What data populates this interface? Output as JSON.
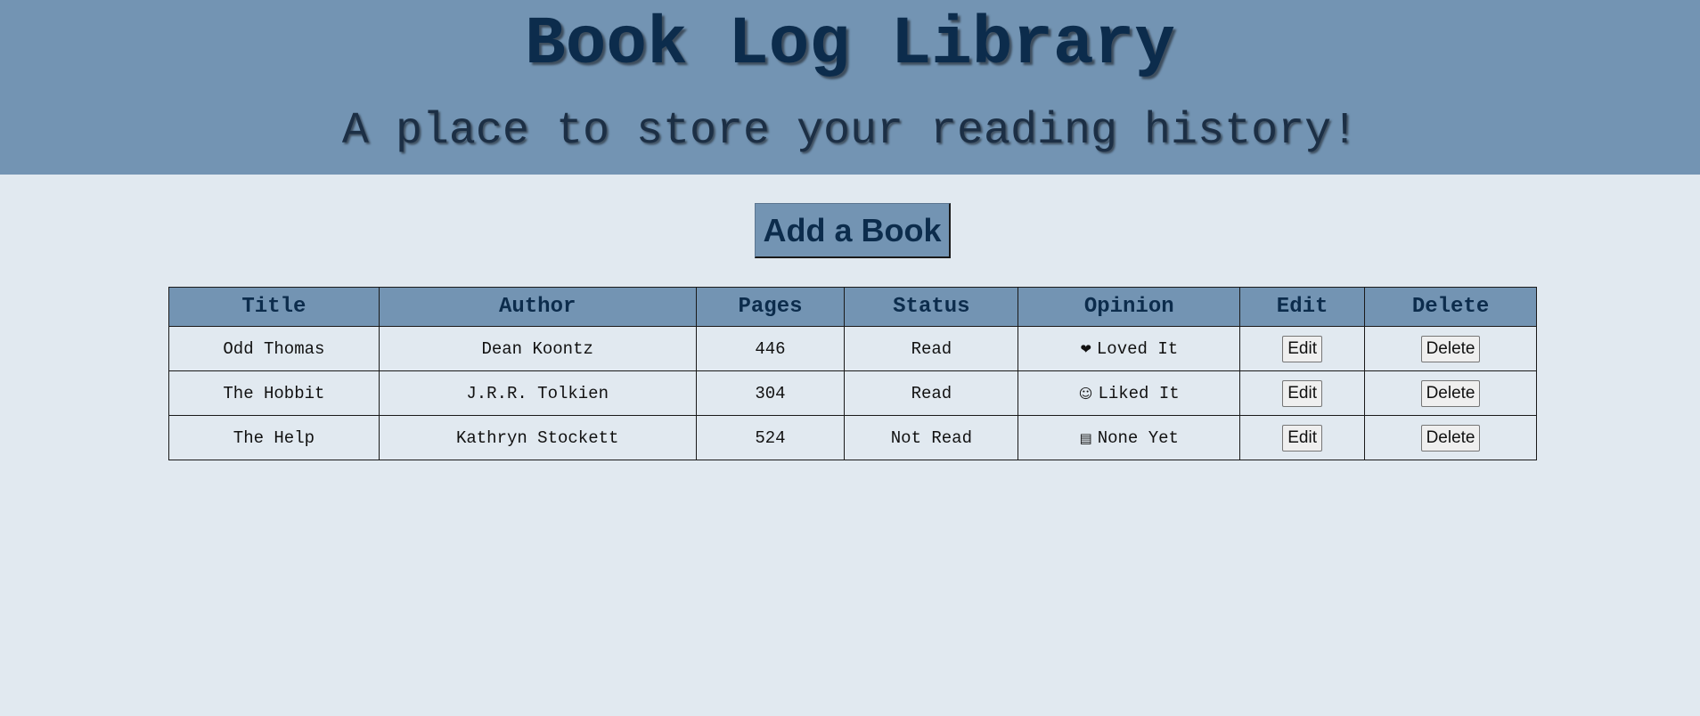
{
  "header": {
    "title": "Book Log Library",
    "subtitle": "A place to store your reading history!"
  },
  "actions": {
    "add_book_label": "Add a Book"
  },
  "table": {
    "columns": [
      "Title",
      "Author",
      "Pages",
      "Status",
      "Opinion",
      "Edit",
      "Delete"
    ],
    "rows": [
      {
        "title": "Odd Thomas",
        "author": "Dean Koontz",
        "pages": "446",
        "status": "Read",
        "opinion_icon": "❤",
        "opinion_icon_name": "heart-icon",
        "opinion": "Loved It",
        "edit_label": "Edit",
        "delete_label": "Delete"
      },
      {
        "title": "The Hobbit",
        "author": "J.R.R. Tolkien",
        "pages": "304",
        "status": "Read",
        "opinion_icon": "☺",
        "opinion_icon_name": "smiley-face-icon",
        "opinion": "Liked It",
        "edit_label": "Edit",
        "delete_label": "Delete"
      },
      {
        "title": "The Help",
        "author": "Kathryn Stockett",
        "pages": "524",
        "status": "Not Read",
        "opinion_icon": "▤",
        "opinion_icon_name": "books-icon",
        "opinion": "None Yet",
        "edit_label": "Edit",
        "delete_label": "Delete"
      }
    ]
  },
  "colors": {
    "header_background": "#7394b3",
    "page_background": "#e1e9f0",
    "title_text": "#0c2c4c"
  }
}
